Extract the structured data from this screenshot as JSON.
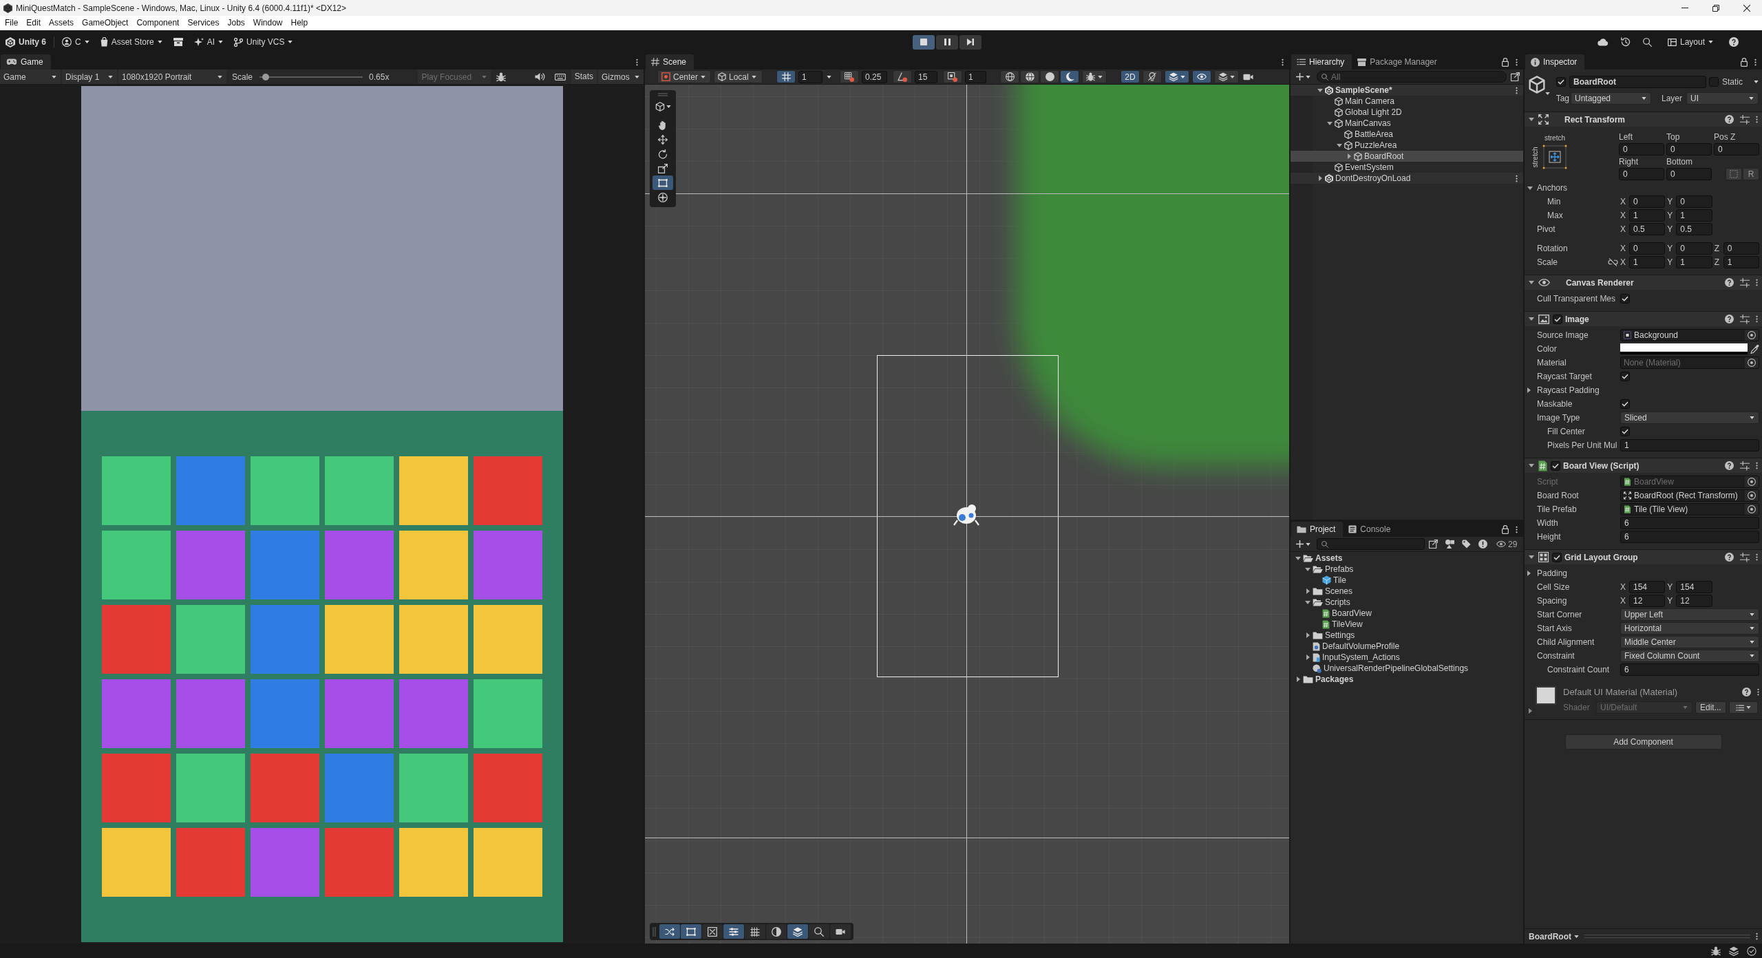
{
  "title_bar": {
    "title": "MiniQuestMatch - SampleScene - Windows, Mac, Linux - Unity 6.4 (6000.4.11f1)* <DX12>"
  },
  "menu_bar": {
    "items": [
      "File",
      "Edit",
      "Assets",
      "GameObject",
      "Component",
      "Services",
      "Jobs",
      "Window",
      "Help"
    ]
  },
  "main_toolbar": {
    "left": [
      {
        "kind": "logo",
        "label": "Unity 6",
        "dropdown": false
      },
      {
        "kind": "account",
        "label": "C",
        "dropdown": true
      },
      {
        "kind": "store",
        "label": "Asset Store",
        "dropdown": true
      },
      {
        "kind": "archive",
        "dropdown": false
      },
      {
        "kind": "ai",
        "label": "AI",
        "dropdown": true
      },
      {
        "kind": "vcs",
        "label": "Unity VCS",
        "dropdown": true
      }
    ],
    "play_controls": [
      {
        "kind": "play",
        "on": true
      },
      {
        "kind": "pause",
        "on": false
      },
      {
        "kind": "step",
        "on": false
      }
    ],
    "right": [
      {
        "kind": "cloud"
      },
      {
        "kind": "history"
      },
      {
        "kind": "search"
      },
      {
        "kind": "layout",
        "label": "Layout",
        "dropdown": true
      },
      {
        "kind": "help"
      }
    ]
  },
  "game_panel": {
    "tabs": [
      {
        "kind": "game",
        "label": "Game",
        "selected": true
      }
    ],
    "toolbar": {
      "view": "Game",
      "display": "Display 1",
      "resolution": "1080x1920 Portrait",
      "scale": {
        "label": "Scale",
        "level": 0.03,
        "reading": "0.65x"
      },
      "play_mode": {
        "label": "Play Focused",
        "disabled": true
      },
      "stats": "Stats",
      "gizmos": "Gizmos"
    },
    "board": {
      "rows": [
        {
          "tiles": [
            {
              "color": "#44c97a"
            },
            {
              "color": "#2f7de3"
            },
            {
              "color": "#44c97a"
            },
            {
              "color": "#44c97a"
            },
            {
              "color": "#f2c53d"
            },
            {
              "color": "#e53935"
            }
          ]
        },
        {
          "tiles": [
            {
              "color": "#44c97a"
            },
            {
              "color": "#a64ee8"
            },
            {
              "color": "#2f7de3"
            },
            {
              "color": "#a64ee8"
            },
            {
              "color": "#f2c53d"
            },
            {
              "color": "#a64ee8"
            }
          ]
        },
        {
          "tiles": [
            {
              "color": "#e53935"
            },
            {
              "color": "#44c97a"
            },
            {
              "color": "#2f7de3"
            },
            {
              "color": "#f2c53d"
            },
            {
              "color": "#f2c53d"
            },
            {
              "color": "#f2c53d"
            }
          ]
        },
        {
          "tiles": [
            {
              "color": "#a64ee8"
            },
            {
              "color": "#a64ee8"
            },
            {
              "color": "#2f7de3"
            },
            {
              "color": "#a64ee8"
            },
            {
              "color": "#a64ee8"
            },
            {
              "color": "#44c97a"
            }
          ]
        },
        {
          "tiles": [
            {
              "color": "#e53935"
            },
            {
              "color": "#44c97a"
            },
            {
              "color": "#e53935"
            },
            {
              "color": "#2f7de3"
            },
            {
              "color": "#44c97a"
            },
            {
              "color": "#e53935"
            }
          ]
        },
        {
          "tiles": [
            {
              "color": "#f2c53d"
            },
            {
              "color": "#e53935"
            },
            {
              "color": "#a64ee8"
            },
            {
              "color": "#e53935"
            },
            {
              "color": "#f2c53d"
            },
            {
              "color": "#f2c53d"
            }
          ]
        }
      ]
    }
  },
  "scene_panel": {
    "tabs": [
      {
        "kind": "scene",
        "label": "Scene",
        "selected": true
      }
    ],
    "toolbar": {
      "pivot": "Center",
      "space": "Local",
      "grid_snap": {
        "selected": true,
        "value": "1"
      },
      "move_snap": "0.25",
      "rotate_snap": "15",
      "scale_snap": "1",
      "draw_modes": [
        {
          "kind": "wireframe",
          "selected": false
        },
        {
          "kind": "shaded-wireframe",
          "selected": false
        },
        {
          "kind": "unlit",
          "selected": false
        },
        {
          "kind": "lit",
          "selected": true
        }
      ],
      "toggles": [
        {
          "kind": "dimension",
          "label": "2D",
          "selected": true
        },
        {
          "kind": "lighting",
          "selected": false
        },
        {
          "kind": "effects",
          "selected": true
        },
        {
          "kind": "visibility",
          "selected": true
        },
        {
          "kind": "layers",
          "selected": false
        }
      ]
    },
    "tool_palette": [
      {
        "kind": "view",
        "selected": false
      },
      {
        "kind": "hand",
        "selected": false
      },
      {
        "kind": "move",
        "selected": false
      },
      {
        "kind": "rotate",
        "selected": false
      },
      {
        "kind": "scale",
        "selected": false
      },
      {
        "kind": "rect",
        "selected": true
      },
      {
        "kind": "transform",
        "selected": false
      }
    ],
    "overlay_toolbar": [
      {
        "kind": "shuffle",
        "selected": true
      },
      {
        "kind": "rect",
        "selected": true
      },
      {
        "kind": "transform-box",
        "selected": false
      },
      {
        "kind": "sliders",
        "selected": true
      },
      {
        "kind": "grid-lines",
        "selected": false
      },
      {
        "kind": "half-circle",
        "selected": false
      },
      {
        "kind": "layers",
        "selected": true
      },
      {
        "kind": "search",
        "selected": false
      },
      {
        "kind": "camera",
        "selected": false
      }
    ]
  },
  "hierarchy_panel": {
    "tabs": [
      {
        "kind": "hierarchy",
        "label": "Hierarchy",
        "selected": true
      },
      {
        "kind": "packages",
        "label": "Package Manager",
        "selected": false
      }
    ],
    "search": {
      "placeholder": "All"
    },
    "tree": [
      {
        "kind": "active-scene",
        "label": "SampleScene*",
        "expanded": true,
        "selected": false,
        "children": [
          {
            "kind": "object",
            "label": "Main Camera",
            "selected": false
          },
          {
            "kind": "object",
            "label": "Global Light 2D",
            "selected": false
          },
          {
            "kind": "object",
            "label": "MainCanvas",
            "expanded": true,
            "selected": false,
            "children": [
              {
                "kind": "object",
                "label": "BattleArea",
                "selected": false
              },
              {
                "kind": "object",
                "label": "PuzzleArea",
                "expanded": true,
                "selected": false,
                "children": [
                  {
                    "kind": "object",
                    "label": "BoardRoot",
                    "expanded": false,
                    "selected": true
                  }
                ]
              }
            ]
          },
          {
            "kind": "object",
            "label": "EventSystem",
            "selected": false
          }
        ]
      },
      {
        "kind": "scene",
        "label": "DontDestroyOnLoad",
        "expanded": false,
        "selected": false
      }
    ]
  },
  "project_panel": {
    "tabs": [
      {
        "kind": "project",
        "label": "Project",
        "selected": true
      },
      {
        "kind": "console",
        "label": "Console",
        "selected": false
      }
    ],
    "visible_count": "29",
    "tree": [
      {
        "kind": "folder",
        "label": "Assets",
        "expanded": true,
        "selected": false,
        "children": [
          {
            "kind": "folder",
            "label": "Prefabs",
            "expanded": true,
            "selected": false,
            "children": [
              {
                "kind": "prefab",
                "label": "Tile",
                "selected": false
              }
            ]
          },
          {
            "kind": "folder",
            "label": "Scenes",
            "expanded": false,
            "selected": false
          },
          {
            "kind": "folder",
            "label": "Scripts",
            "expanded": true,
            "selected": false,
            "children": [
              {
                "kind": "script",
                "label": "BoardView",
                "selected": false
              },
              {
                "kind": "script",
                "label": "TileView",
                "selected": false
              }
            ]
          },
          {
            "kind": "folder",
            "label": "Settings",
            "expanded": false,
            "selected": false
          },
          {
            "kind": "volume",
            "label": "DefaultVolumeProfile",
            "selected": false
          },
          {
            "kind": "input-actions",
            "label": "InputSystem_Actions",
            "expanded": false,
            "selected": false
          },
          {
            "kind": "render-settings",
            "label": "UniversalRenderPipelineGlobalSettings",
            "selected": false
          }
        ]
      },
      {
        "kind": "folder",
        "label": "Packages",
        "expanded": false,
        "selected": false
      }
    ]
  },
  "inspector_panel": {
    "tabs": [
      {
        "kind": "inspector",
        "label": "Inspector",
        "selected": true
      }
    ],
    "object": {
      "active": true,
      "name": "BoardRoot",
      "static": false,
      "static_label": "Static",
      "tag_label": "Tag",
      "tag": "Untagged",
      "layer_label": "Layer",
      "layer": "UI"
    },
    "components": [
      {
        "kind": "rect-transform",
        "title": "Rect Transform",
        "expanded": true,
        "anchor_preset": {
          "horizontal": "stretch",
          "vertical": "stretch"
        },
        "edges": [
          {
            "label": "Left",
            "value": "0"
          },
          {
            "label": "Top",
            "value": "0"
          },
          {
            "label": "Pos Z",
            "value": "0"
          },
          {
            "label": "Right",
            "value": "0"
          },
          {
            "label": "Bottom",
            "value": "0"
          }
        ],
        "raw_edit_button": "R",
        "rows": [
          {
            "kind": "foldout",
            "label": "Anchors",
            "expanded": true,
            "children": [
              {
                "kind": "vector2",
                "label": "Min",
                "values": [
                  {
                    "axis": "X",
                    "value": "0"
                  },
                  {
                    "axis": "Y",
                    "value": "0"
                  }
                ]
              },
              {
                "kind": "vector2",
                "label": "Max",
                "values": [
                  {
                    "axis": "X",
                    "value": "1"
                  },
                  {
                    "axis": "Y",
                    "value": "1"
                  }
                ]
              }
            ]
          },
          {
            "kind": "vector2",
            "label": "Pivot",
            "values": [
              {
                "axis": "X",
                "value": "0.5"
              },
              {
                "axis": "Y",
                "value": "0.5"
              }
            ]
          },
          {
            "kind": "vector3",
            "label": "Rotation",
            "values": [
              {
                "axis": "X",
                "value": "0"
              },
              {
                "axis": "Y",
                "value": "0"
              },
              {
                "axis": "Z",
                "value": "0"
              }
            ]
          },
          {
            "kind": "vector3",
            "label": "Scale",
            "linked": false,
            "values": [
              {
                "axis": "X",
                "value": "1"
              },
              {
                "axis": "Y",
                "value": "1"
              },
              {
                "axis": "Z",
                "value": "1"
              }
            ]
          }
        ]
      },
      {
        "kind": "canvas-renderer",
        "title": "Canvas Renderer",
        "expanded": true,
        "rows": [
          {
            "kind": "checkbox",
            "label": "Cull Transparent Mes",
            "checked": true
          }
        ]
      },
      {
        "kind": "image",
        "title": "Image",
        "enabled": true,
        "expanded": true,
        "rows": [
          {
            "kind": "object",
            "label": "Source Image",
            "asset": {
              "kind": "sprite"
            },
            "value": "Background"
          },
          {
            "kind": "color",
            "label": "Color",
            "color": "#ffffff"
          },
          {
            "kind": "object",
            "label": "Material",
            "value": "None (Material)",
            "empty": true
          },
          {
            "kind": "checkbox",
            "label": "Raycast Target",
            "checked": true
          },
          {
            "kind": "foldout",
            "label": "Raycast Padding",
            "expanded": false
          },
          {
            "kind": "checkbox",
            "label": "Maskable",
            "checked": true
          },
          {
            "kind": "dropdown",
            "label": "Image Type",
            "value": "Sliced",
            "children": [
              {
                "kind": "checkbox",
                "label": "Fill Center",
                "checked": true
              },
              {
                "kind": "number",
                "label": "Pixels Per Unit Mul",
                "value": "1"
              }
            ]
          }
        ]
      },
      {
        "kind": "script",
        "title": "Board View (Script)",
        "enabled": true,
        "expanded": true,
        "rows": [
          {
            "kind": "object",
            "label": "Script",
            "asset": {
              "kind": "script"
            },
            "value": "BoardView",
            "disabled": true
          },
          {
            "kind": "object",
            "label": "Board Root",
            "asset": {
              "kind": "transform"
            },
            "value": "BoardRoot (Rect Transform)"
          },
          {
            "kind": "object",
            "label": "Tile Prefab",
            "asset": {
              "kind": "script"
            },
            "value": "Tile (Tile View)"
          },
          {
            "kind": "number",
            "label": "Width",
            "value": "6"
          },
          {
            "kind": "number",
            "label": "Height",
            "value": "6"
          }
        ]
      },
      {
        "kind": "grid-layout",
        "title": "Grid Layout Group",
        "enabled": true,
        "expanded": true,
        "rows": [
          {
            "kind": "foldout",
            "label": "Padding",
            "expanded": false
          },
          {
            "kind": "vector2",
            "label": "Cell Size",
            "values": [
              {
                "axis": "X",
                "value": "154"
              },
              {
                "axis": "Y",
                "value": "154"
              }
            ]
          },
          {
            "kind": "vector2",
            "label": "Spacing",
            "values": [
              {
                "axis": "X",
                "value": "12"
              },
              {
                "axis": "Y",
                "value": "12"
              }
            ]
          },
          {
            "kind": "dropdown",
            "label": "Start Corner",
            "value": "Upper Left"
          },
          {
            "kind": "dropdown",
            "label": "Start Axis",
            "value": "Horizontal"
          },
          {
            "kind": "dropdown",
            "label": "Child Alignment",
            "value": "Middle Center"
          },
          {
            "kind": "dropdown",
            "label": "Constraint",
            "value": "Fixed Column Count",
            "children": [
              {
                "kind": "number",
                "label": "Constraint Count",
                "value": "6"
              }
            ]
          }
        ]
      }
    ],
    "material": {
      "title": "Default UI Material (Material)",
      "expanded": false,
      "shader_label": "Shader",
      "shader": "UI/Default",
      "edit_button": "Edit..."
    },
    "add_component_button": "Add Component",
    "preview": {
      "title": "BoardRoot"
    }
  }
}
